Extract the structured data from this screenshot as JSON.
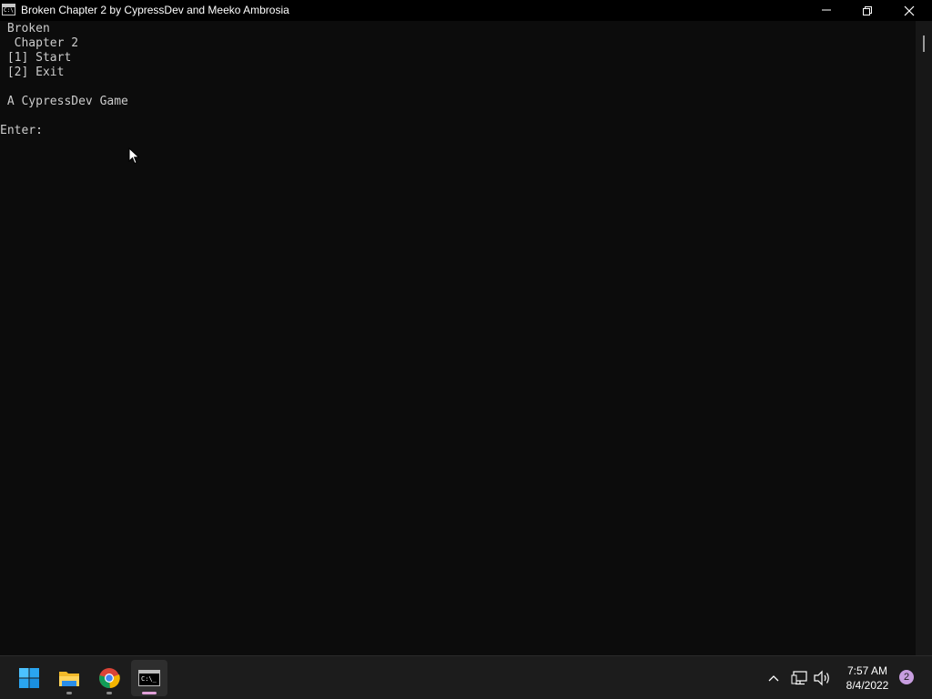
{
  "window": {
    "title": "Broken Chapter 2 by CypressDev and Meeko Ambrosia",
    "icon_text": "C:\\"
  },
  "console": {
    "lines": [
      " Broken",
      "  Chapter 2",
      " [1] Start",
      " [2] Exit",
      "",
      " A CypressDev Game",
      "",
      "Enter:"
    ]
  },
  "taskbar": {
    "items": [
      {
        "name": "Start",
        "icon": "windows-logo-icon"
      },
      {
        "name": "File Explorer",
        "icon": "folder-icon"
      },
      {
        "name": "Google Chrome",
        "icon": "chrome-icon"
      },
      {
        "name": "Command Prompt",
        "icon": "terminal-icon",
        "active": true
      }
    ]
  },
  "tray": {
    "time": "7:57 AM",
    "date": "8/4/2022",
    "notification_count": "2"
  },
  "colors": {
    "console_bg": "#0c0c0c",
    "console_text": "#cccccc",
    "titlebar_bg": "#000000",
    "taskbar_bg": "#1c1c1c",
    "accent_badge": "#c89ee0"
  }
}
